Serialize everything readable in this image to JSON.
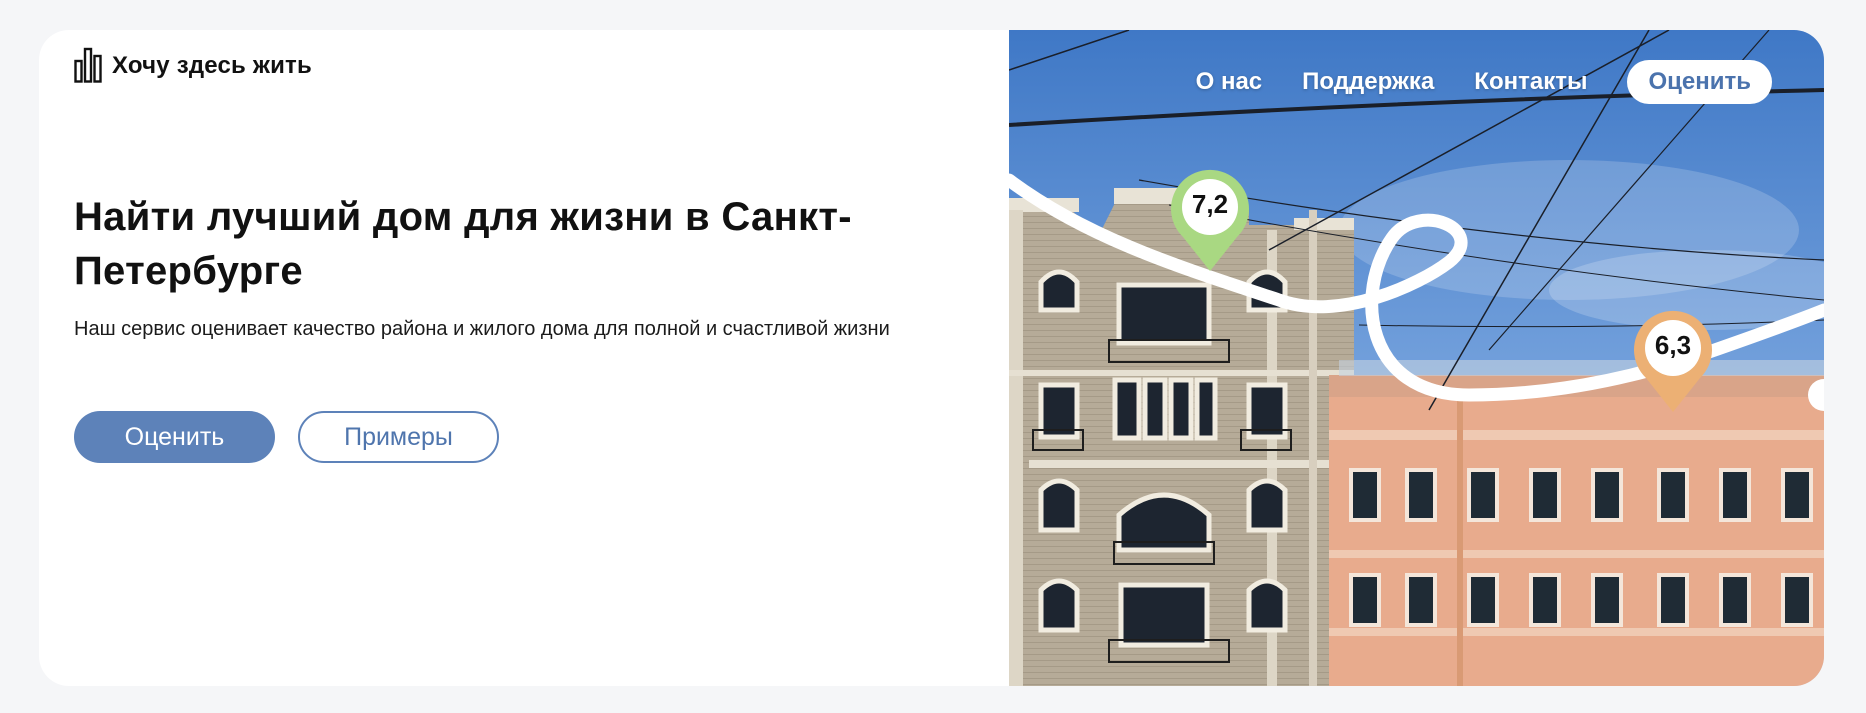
{
  "brand": {
    "name": "Хочу здесь жить",
    "icon": "bar-chart-logo-icon"
  },
  "hero": {
    "title": "Найти лучший дом для жизни в Санкт-Петербурге",
    "subtitle": "Наш сервис оценивает качество района и жилого дома для полной и счастливой жизни",
    "primary_button": "Оценить",
    "secondary_button": "Примеры"
  },
  "nav": {
    "items": [
      "О нас",
      "Поддержка",
      "Контакты"
    ],
    "cta": "Оценить"
  },
  "map_pins": [
    {
      "score": "7,2",
      "color": "#a9d882"
    },
    {
      "score": "6,3",
      "color": "#ecb074"
    }
  ],
  "colors": {
    "accent": "#5d82b9",
    "background": "#f5f6f8"
  }
}
